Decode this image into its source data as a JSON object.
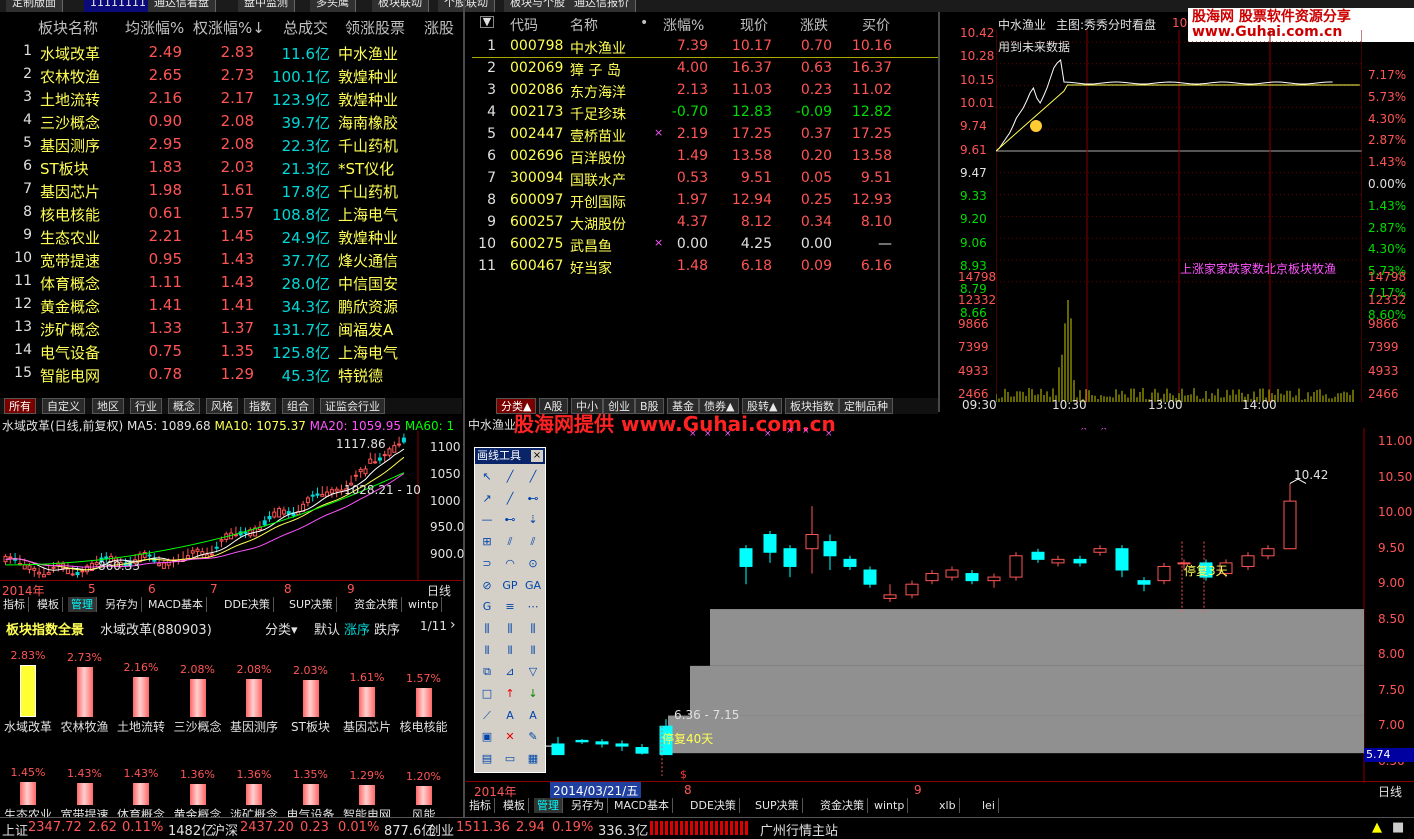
{
  "top_tabs": [
    "定制版面",
    "11111111",
    "通达信看盘",
    "盘中监测",
    "多头鹰",
    "板块联动",
    "个股联动",
    "板块与个股",
    "通达信报价"
  ],
  "left_table": {
    "headers": [
      "板块名称",
      "均涨幅%",
      "权涨幅%↓",
      "总成交",
      "领涨股票",
      "涨股"
    ],
    "rows": [
      {
        "n": "1",
        "name": "水域改革",
        "avg": "2.49",
        "w": "2.83",
        "vol": "11.6亿",
        "lead": "中水渔业"
      },
      {
        "n": "2",
        "name": "农林牧渔",
        "avg": "2.65",
        "w": "2.73",
        "vol": "100.1亿",
        "lead": "敦煌种业"
      },
      {
        "n": "3",
        "name": "土地流转",
        "avg": "2.16",
        "w": "2.17",
        "vol": "123.9亿",
        "lead": "敦煌种业"
      },
      {
        "n": "4",
        "name": "三沙概念",
        "avg": "0.90",
        "w": "2.08",
        "vol": "39.7亿",
        "lead": "海南橡胶"
      },
      {
        "n": "5",
        "name": "基因测序",
        "avg": "2.95",
        "w": "2.08",
        "vol": "22.3亿",
        "lead": "千山药机"
      },
      {
        "n": "6",
        "name": "ST板块",
        "avg": "1.83",
        "w": "2.03",
        "vol": "21.3亿",
        "lead": "*ST仪化"
      },
      {
        "n": "7",
        "name": "基因芯片",
        "avg": "1.98",
        "w": "1.61",
        "vol": "17.8亿",
        "lead": "千山药机"
      },
      {
        "n": "8",
        "name": "核电核能",
        "avg": "0.61",
        "w": "1.57",
        "vol": "108.8亿",
        "lead": "上海电气"
      },
      {
        "n": "9",
        "name": "生态农业",
        "avg": "2.21",
        "w": "1.45",
        "vol": "24.9亿",
        "lead": "敦煌种业"
      },
      {
        "n": "10",
        "name": "宽带提速",
        "avg": "0.95",
        "w": "1.43",
        "vol": "37.7亿",
        "lead": "烽火通信"
      },
      {
        "n": "11",
        "name": "体育概念",
        "avg": "1.11",
        "w": "1.43",
        "vol": "28.0亿",
        "lead": "中信国安"
      },
      {
        "n": "12",
        "name": "黄金概念",
        "avg": "1.41",
        "w": "1.41",
        "vol": "34.3亿",
        "lead": "鹏欣资源"
      },
      {
        "n": "13",
        "name": "涉矿概念",
        "avg": "1.33",
        "w": "1.37",
        "vol": "131.7亿",
        "lead": "闽福发A"
      },
      {
        "n": "14",
        "name": "电气设备",
        "avg": "0.75",
        "w": "1.35",
        "vol": "125.8亿",
        "lead": "上海电气"
      },
      {
        "n": "15",
        "name": "智能电网",
        "avg": "0.78",
        "w": "1.29",
        "vol": "45.3亿",
        "lead": "特锐德"
      }
    ]
  },
  "left_tabs": [
    "所有",
    "自定义",
    "地区",
    "行业",
    "概念",
    "风格",
    "指数",
    "组合",
    "证监会行业"
  ],
  "kline_left": {
    "title": "水域改革(日线,前复权)",
    "ma5": "MA5: 1089.68",
    "ma10": "MA10: 1075.37",
    "ma20": "MA20: 1059.95",
    "ma60": "MA60: 1",
    "hi": "1117.86",
    "mid": "1028.21 - 10",
    "lo": "860.33",
    "yticks": [
      "1100",
      "1050",
      "1000",
      "950.0",
      "900.0"
    ],
    "xyear": "2014年",
    "xticks": [
      "5",
      "6",
      "7",
      "8",
      "9"
    ],
    "period": "日线"
  },
  "left_subtabs": [
    "指标",
    "模板",
    "管理",
    "另存为",
    "MACD基本",
    "DDE决策",
    "SUP决策",
    "资金决策",
    "wintp"
  ],
  "sector_panel": {
    "title": "板块指数全景",
    "sector": "水域改革(880903)",
    "sort": "分类▾",
    "options": [
      "默认",
      "涨序",
      "跌序"
    ],
    "page": "1/11",
    "bars": [
      {
        "pct": "2.83%",
        "name": "水域改革",
        "v": 2.83,
        "hl": true
      },
      {
        "pct": "2.73%",
        "name": "农林牧渔",
        "v": 2.73
      },
      {
        "pct": "2.16%",
        "name": "土地流转",
        "v": 2.16
      },
      {
        "pct": "2.08%",
        "name": "三沙概念",
        "v": 2.08
      },
      {
        "pct": "2.08%",
        "name": "基因测序",
        "v": 2.08
      },
      {
        "pct": "2.03%",
        "name": "ST板块",
        "v": 2.03
      },
      {
        "pct": "1.61%",
        "name": "基因芯片",
        "v": 1.61
      },
      {
        "pct": "1.57%",
        "name": "核电核能",
        "v": 1.57
      },
      {
        "pct": "1.45%",
        "name": "生态农业",
        "v": 1.45
      },
      {
        "pct": "1.43%",
        "name": "宽带提速",
        "v": 1.43
      },
      {
        "pct": "1.43%",
        "name": "体育概念",
        "v": 1.43
      },
      {
        "pct": "1.36%",
        "name": "黄金概念",
        "v": 1.36
      },
      {
        "pct": "1.36%",
        "name": "涉矿概念",
        "v": 1.36
      },
      {
        "pct": "1.35%",
        "name": "电气设备",
        "v": 1.35
      },
      {
        "pct": "1.29%",
        "name": "智能电网",
        "v": 1.29
      },
      {
        "pct": "1.20%",
        "name": "风能",
        "v": 1.2
      }
    ]
  },
  "mid_table": {
    "headers": [
      "代码",
      "名称",
      "•",
      "涨幅%",
      "现价",
      "涨跌",
      "买价"
    ],
    "rows": [
      {
        "n": "1",
        "code": "000798",
        "name": "中水渔业",
        "mk": "",
        "chg": "7.39",
        "px": "10.17",
        "d": "0.70",
        "bid": "10.16",
        "c": "r"
      },
      {
        "n": "2",
        "code": "002069",
        "name": "獐 子 岛",
        "mk": "",
        "chg": "4.00",
        "px": "16.37",
        "d": "0.63",
        "bid": "16.37",
        "c": "r"
      },
      {
        "n": "3",
        "code": "002086",
        "name": "东方海洋",
        "mk": "",
        "chg": "2.13",
        "px": "11.03",
        "d": "0.23",
        "bid": "11.02",
        "c": "r"
      },
      {
        "n": "4",
        "code": "002173",
        "name": "千足珍珠",
        "mk": "",
        "chg": "-0.70",
        "px": "12.83",
        "d": "-0.09",
        "bid": "12.82",
        "c": "g"
      },
      {
        "n": "5",
        "code": "002447",
        "name": "壹桥苗业",
        "mk": "×",
        "chg": "2.19",
        "px": "17.25",
        "d": "0.37",
        "bid": "17.25",
        "c": "r"
      },
      {
        "n": "6",
        "code": "002696",
        "name": "百洋股份",
        "mk": "",
        "chg": "1.49",
        "px": "13.58",
        "d": "0.20",
        "bid": "13.58",
        "c": "r"
      },
      {
        "n": "7",
        "code": "300094",
        "name": "国联水产",
        "mk": "",
        "chg": "0.53",
        "px": "9.51",
        "d": "0.05",
        "bid": "9.51",
        "c": "r"
      },
      {
        "n": "8",
        "code": "600097",
        "name": "开创国际",
        "mk": "",
        "chg": "1.97",
        "px": "12.94",
        "d": "0.25",
        "bid": "12.93",
        "c": "r"
      },
      {
        "n": "9",
        "code": "600257",
        "name": "大湖股份",
        "mk": "",
        "chg": "4.37",
        "px": "8.12",
        "d": "0.34",
        "bid": "8.10",
        "c": "r"
      },
      {
        "n": "10",
        "code": "600275",
        "name": "武昌鱼",
        "mk": "×",
        "chg": "0.00",
        "px": "4.25",
        "d": "0.00",
        "bid": "—",
        "c": "w"
      },
      {
        "n": "11",
        "code": "600467",
        "name": "好当家",
        "mk": "",
        "chg": "1.48",
        "px": "6.18",
        "d": "0.09",
        "bid": "6.16",
        "c": "r"
      }
    ]
  },
  "mid_tabs": [
    "分类▲",
    "A股",
    "中小",
    "创业",
    "B股",
    "基金",
    "债券▲",
    "股转▲",
    "板块指数",
    "定制品种"
  ],
  "intraday": {
    "name": "中水渔业",
    "title": "主图:秀秀分时看盘",
    "price_top": "10.17",
    "note": "用到未来数据",
    "watermark": "股海网 股票软件资源分享 www.Guhai.com.cn",
    "lprices": [
      "10.42",
      "10.28",
      "10.15",
      "10.01",
      "9.74",
      "9.61",
      "9.47",
      "9.33",
      "9.20",
      "9.06",
      "8.93",
      "8.79",
      "8.66"
    ],
    "rpcts": [
      "7.17%",
      "5.73%",
      "4.30%",
      "2.87%",
      "1.43%",
      "0.00%",
      "1.43%",
      "2.87%",
      "4.30%",
      "5.73%",
      "7.17%",
      "8.60%"
    ],
    "vols": [
      "14798",
      "12332",
      "9866",
      "7399",
      "4933",
      "2466"
    ],
    "times": [
      "09:30",
      "10:30",
      "13:00",
      "14:00"
    ],
    "ticker": "上涨家家跌家数北京板块牧渔"
  },
  "kline_main": {
    "title": "中水渔业",
    "wm": "股海网提供 www.Guhai.com.cn",
    "yticks": [
      "11.00",
      "10.50",
      "10.00",
      "9.50",
      "9.00",
      "8.50",
      "8.00",
      "7.50",
      "7.00",
      "6.50"
    ],
    "hi": "10.42",
    "lo": "6.36 - 7.15",
    "halt1": "停复40天",
    "halt2": "停复3天",
    "date": "2014/03/21/五",
    "xyear": "2014年",
    "xticks": [
      "8",
      "9"
    ],
    "price_box": "5.74",
    "period": "日线"
  },
  "draw_tool": {
    "title": "画线工具"
  },
  "bottom_subtabs": [
    "指标",
    "模板",
    "管理",
    "另存为",
    "MACD基本",
    "DDE决策",
    "SUP决策",
    "资金决策",
    "wintp",
    "xlb",
    "lei"
  ],
  "status": {
    "sh": "上证",
    "sh_v": "2347.72",
    "sh_d": "2.62",
    "sh_p": "0.11%",
    "sh_amt": "1482亿",
    "sz": "沪深",
    "sz_v": "2437.20",
    "sz_d": "0.23",
    "sz_p": "0.01%",
    "sz_amt": "877.6亿",
    "cy": "创业",
    "cy_v": "1511.36",
    "cy_d": "2.94",
    "cy_p": "0.19%",
    "cy_amt": "336.3亿",
    "server": "广州行情主站"
  }
}
